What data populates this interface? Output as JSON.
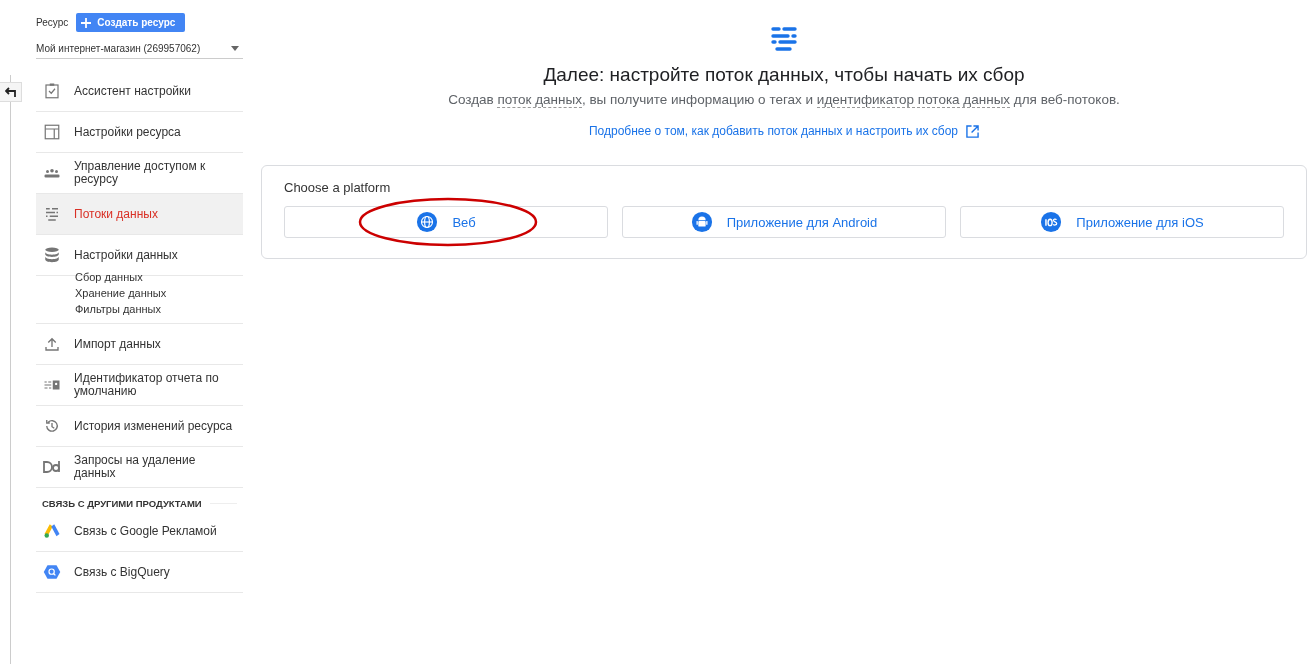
{
  "resource": {
    "label": "Ресурс",
    "create_button": "Создать ресурс",
    "selector": "Мой интернет-магазин (269957062)"
  },
  "sidebar": {
    "items": [
      {
        "kind": "item",
        "label": "Ассистент настройки",
        "selected": false
      },
      {
        "kind": "item",
        "label": "Настройки ресурса",
        "selected": false
      },
      {
        "kind": "item",
        "label": "Управление доступом к ресурсу",
        "selected": false
      },
      {
        "kind": "item",
        "label": "Потоки данных",
        "selected": true
      },
      {
        "kind": "item",
        "label": "Настройки данных",
        "selected": false,
        "children": [
          {
            "label": "Сбор данных"
          },
          {
            "label": "Хранение данных"
          },
          {
            "label": "Фильтры данных"
          }
        ]
      },
      {
        "kind": "item",
        "label": "Импорт данных",
        "selected": false
      },
      {
        "kind": "item",
        "label": "Идентификатор отчета по умолчанию",
        "selected": false
      },
      {
        "kind": "item",
        "label": "История изменений ресурса",
        "selected": false
      },
      {
        "kind": "item",
        "label": "Запросы на удаление данных",
        "selected": false
      },
      {
        "kind": "header",
        "label": "СВЯЗЬ С ДРУГИМИ ПРОДУКТАМИ"
      },
      {
        "kind": "item",
        "label": "Связь с Google Рекламой",
        "selected": false
      },
      {
        "kind": "item",
        "label": "Связь с BigQuery",
        "selected": false
      }
    ]
  },
  "main": {
    "title": "Далее: настройте поток данных, чтобы начать их сбор",
    "subtitle": [
      {
        "kind": "text",
        "text": "Создав "
      },
      {
        "kind": "term",
        "text": "поток данных"
      },
      {
        "kind": "text",
        "text": ", вы получите информацию о тегах и "
      },
      {
        "kind": "term",
        "text": "идентификатор потока данных"
      },
      {
        "kind": "text",
        "text": " для веб-потоков."
      }
    ],
    "link": "Подробнее о том, как добавить поток данных и настроить их сбор",
    "platform_card": {
      "heading": "Choose a platform",
      "platforms": [
        {
          "label": "Веб"
        },
        {
          "label": "Приложение для Android"
        },
        {
          "label": "Приложение для iOS"
        }
      ]
    }
  }
}
